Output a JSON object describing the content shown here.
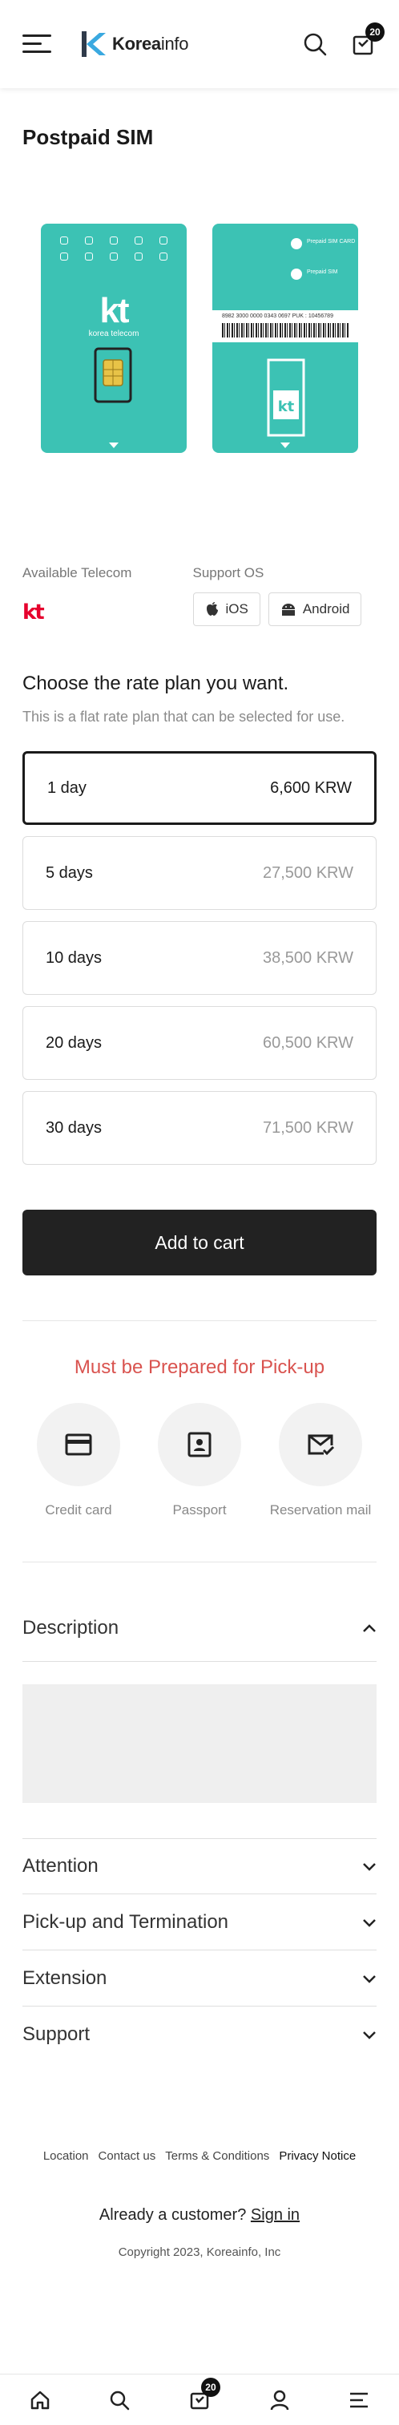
{
  "header": {
    "logo_bold": "Korea",
    "logo_thin": "info",
    "cart_count": "20"
  },
  "product": {
    "title": "Postpaid SIM",
    "sim_front_brand": "kt",
    "sim_front_sub": "korea telecom",
    "sim_back_line1": "Prepaid SIM CARD",
    "sim_back_line2": "Prepaid SIM",
    "sim_back_barcode_text": "8982 3000 0000 0343 0697   PUK : 10456789"
  },
  "specs": {
    "telecom_label": "Available Telecom",
    "telecom_value": "kt",
    "os_label": "Support OS",
    "os_options": [
      "iOS",
      "Android"
    ]
  },
  "rate": {
    "title": "Choose the rate plan you want.",
    "subtitle": "This is a flat rate plan that can be selected for use.",
    "plans": [
      {
        "days": "1 day",
        "price": "6,600 KRW",
        "selected": true
      },
      {
        "days": "5 days",
        "price": "27,500 KRW",
        "selected": false
      },
      {
        "days": "10 days",
        "price": "38,500 KRW",
        "selected": false
      },
      {
        "days": "20 days",
        "price": "60,500 KRW",
        "selected": false
      },
      {
        "days": "30 days",
        "price": "71,500 KRW",
        "selected": false
      }
    ]
  },
  "cart_button": "Add to cart",
  "pickup": {
    "title": "Must be Prepared for Pick-up",
    "items": [
      {
        "label": "Credit card",
        "icon": "credit-card-icon"
      },
      {
        "label": "Passport",
        "icon": "passport-icon"
      },
      {
        "label": "Reservation mail",
        "icon": "mail-check-icon"
      }
    ]
  },
  "accordion": {
    "description": "Description",
    "attention": "Attention",
    "pickup_termination": "Pick-up and Termination",
    "extension": "Extension",
    "support": "Support"
  },
  "footer": {
    "links": [
      "Location",
      "Contact us",
      "Terms & Conditions",
      "Privacy Notice"
    ],
    "customer_prefix": "Already a customer?",
    "sign_in": "Sign in",
    "copyright": "Copyright 2023, Koreainfo, Inc"
  },
  "bottom_nav": {
    "cart_count": "20"
  },
  "colors": {
    "sim": "#3cc2b4",
    "accent_red": "#d9534f",
    "kt_red": "#e6002d",
    "dark": "#222222"
  }
}
